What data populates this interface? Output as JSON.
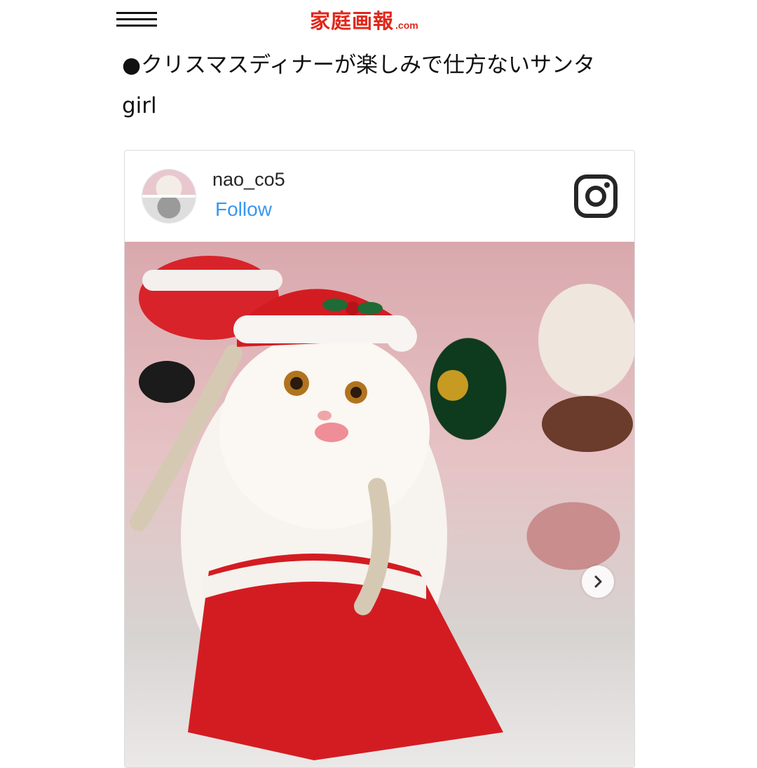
{
  "header": {
    "logo_main": "家庭画報",
    "logo_sub": ".com",
    "brand_color": "#e0271a"
  },
  "article": {
    "headline": "●クリスマスディナーが楽しみで仕方ないサンタgirl"
  },
  "instagram_embed": {
    "username": "nao_co5",
    "follow_label": "Follow",
    "follow_color": "#3897f0",
    "icons": {
      "menu": "hamburger-menu-icon",
      "platform": "instagram-icon",
      "next": "chevron-right-icon"
    }
  }
}
